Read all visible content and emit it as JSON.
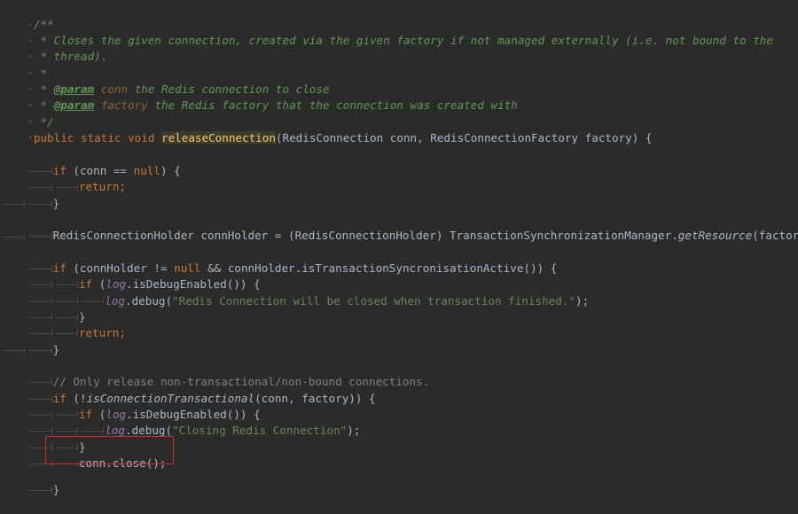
{
  "code": {
    "l1": "/**",
    "l2": " * Closes the given connection, created via the given factory if not managed externally (i.e. not bound to the",
    "l3": " * thread).",
    "l4": " *",
    "l5": {
      "prefix": " * ",
      "tag": "@param",
      "name": " conn",
      "desc": " the Redis connection to close"
    },
    "l6": {
      "prefix": " * ",
      "tag": "@param",
      "name": " factory",
      "desc": " the Redis factory that the connection was created with"
    },
    "l7": " */",
    "l8": {
      "kw": "public static void ",
      "method": "releaseConnection",
      "rest": "(RedisConnection conn, RedisConnectionFactory factory) {"
    },
    "l10": {
      "kw": "if",
      "a": " (conn == ",
      "kw2": "null",
      "b": ") {"
    },
    "l11": {
      "kw": "return",
      "b": ";"
    },
    "l12": "}",
    "l14": {
      "a": "RedisConnectionHolder connHolder = (RedisConnectionHolder) TransactionSynchronizationManager.",
      "stat": "getResource",
      "b": "(factory);"
    },
    "l16": {
      "kw": "if",
      "a": " (connHolder != ",
      "kw2": "null",
      "b": " && connHolder.isTransactionSyncronisationActive()) {"
    },
    "l17": {
      "kw": "if",
      "a": " (",
      "fld": "log",
      "b": ".isDebugEnabled()) {"
    },
    "l18": {
      "fld": "log",
      "a": ".debug(",
      "str": "\"Redis Connection will be closed when transaction finished.\"",
      "b": ");"
    },
    "l19": "}",
    "l20": {
      "kw": "return",
      "b": ";"
    },
    "l21": "}",
    "l23": "// Only release non-transactional/non-bound connections.",
    "l24": {
      "kw": "if",
      "a": " (!",
      "stat": "isConnectionTransactional",
      "b": "(conn, factory)) {"
    },
    "l25": {
      "kw": "if",
      "a": " (",
      "fld": "log",
      "b": ".isDebugEnabled()) {"
    },
    "l26": {
      "fld": "log",
      "a": ".debug(",
      "str": "\"Closing Redis Connection\"",
      "b": ");"
    },
    "l27": "}",
    "l28": "conn.close();",
    "l29": "}"
  },
  "colors": {
    "background": "#2b2b2b",
    "keyword": "#cc7832",
    "javadoc": "#629755",
    "string": "#6a8759",
    "field": "#9876aa",
    "method_declaration": "#ffc66d",
    "highlight_box": "#e0242a"
  }
}
